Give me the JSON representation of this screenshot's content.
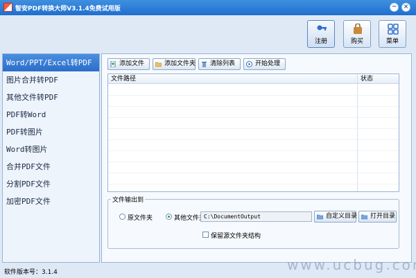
{
  "window": {
    "title": "智安PDF转换大师V3.1.4免费试用版",
    "min_glyph": "−",
    "close_glyph": "×"
  },
  "toolbar": {
    "register_label": "注册",
    "buy_label": "购买",
    "menu_label": "菜单"
  },
  "sidebar": {
    "items": [
      {
        "label": "Word/PPT/Excel转PDF",
        "active": true
      },
      {
        "label": "图片合并转PDF"
      },
      {
        "label": "其他文件转PDF"
      },
      {
        "label": "PDF转Word"
      },
      {
        "label": "PDF转图片"
      },
      {
        "label": "Word转图片"
      },
      {
        "label": "合并PDF文件"
      },
      {
        "label": "分割PDF文件"
      },
      {
        "label": "加密PDF文件"
      }
    ]
  },
  "actions": {
    "add_file": "添加文件",
    "add_folder": "添加文件夹",
    "clear_list": "清除列表",
    "start": "开始处理"
  },
  "file_list": {
    "columns": [
      "文件路径",
      "状态"
    ],
    "rows": []
  },
  "output": {
    "group_title": "文件输出到",
    "option_original": "原文件夹",
    "option_other": "其他文件夹",
    "selected": "其他文件夹",
    "path_value": "C:\\DocumentOutput",
    "custom_dir_button": "自定义目录",
    "open_dir_button": "打开目录",
    "keep_structure_label": "保留源文件夹结构",
    "keep_structure_checked": false
  },
  "status": {
    "version_text": "软件版本号：3.1.4"
  },
  "watermark": "www.ucbug.com",
  "colors": {
    "titlebar": "#2a7bd6",
    "sidebar_active": "#3a7fd8",
    "background": "#dfe9f6"
  },
  "icons": {
    "register": "key-icon",
    "buy": "shopping-bag-icon",
    "menu": "grid-icon"
  }
}
